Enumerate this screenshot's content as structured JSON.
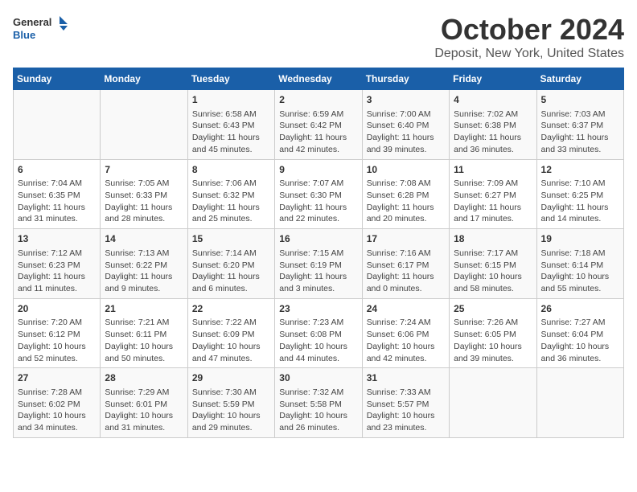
{
  "header": {
    "logo_line1": "General",
    "logo_line2": "Blue",
    "month_title": "October 2024",
    "location": "Deposit, New York, United States"
  },
  "weekdays": [
    "Sunday",
    "Monday",
    "Tuesday",
    "Wednesday",
    "Thursday",
    "Friday",
    "Saturday"
  ],
  "weeks": [
    [
      {
        "day": "",
        "info": ""
      },
      {
        "day": "",
        "info": ""
      },
      {
        "day": "1",
        "info": "Sunrise: 6:58 AM\nSunset: 6:43 PM\nDaylight: 11 hours and 45 minutes."
      },
      {
        "day": "2",
        "info": "Sunrise: 6:59 AM\nSunset: 6:42 PM\nDaylight: 11 hours and 42 minutes."
      },
      {
        "day": "3",
        "info": "Sunrise: 7:00 AM\nSunset: 6:40 PM\nDaylight: 11 hours and 39 minutes."
      },
      {
        "day": "4",
        "info": "Sunrise: 7:02 AM\nSunset: 6:38 PM\nDaylight: 11 hours and 36 minutes."
      },
      {
        "day": "5",
        "info": "Sunrise: 7:03 AM\nSunset: 6:37 PM\nDaylight: 11 hours and 33 minutes."
      }
    ],
    [
      {
        "day": "6",
        "info": "Sunrise: 7:04 AM\nSunset: 6:35 PM\nDaylight: 11 hours and 31 minutes."
      },
      {
        "day": "7",
        "info": "Sunrise: 7:05 AM\nSunset: 6:33 PM\nDaylight: 11 hours and 28 minutes."
      },
      {
        "day": "8",
        "info": "Sunrise: 7:06 AM\nSunset: 6:32 PM\nDaylight: 11 hours and 25 minutes."
      },
      {
        "day": "9",
        "info": "Sunrise: 7:07 AM\nSunset: 6:30 PM\nDaylight: 11 hours and 22 minutes."
      },
      {
        "day": "10",
        "info": "Sunrise: 7:08 AM\nSunset: 6:28 PM\nDaylight: 11 hours and 20 minutes."
      },
      {
        "day": "11",
        "info": "Sunrise: 7:09 AM\nSunset: 6:27 PM\nDaylight: 11 hours and 17 minutes."
      },
      {
        "day": "12",
        "info": "Sunrise: 7:10 AM\nSunset: 6:25 PM\nDaylight: 11 hours and 14 minutes."
      }
    ],
    [
      {
        "day": "13",
        "info": "Sunrise: 7:12 AM\nSunset: 6:23 PM\nDaylight: 11 hours and 11 minutes."
      },
      {
        "day": "14",
        "info": "Sunrise: 7:13 AM\nSunset: 6:22 PM\nDaylight: 11 hours and 9 minutes."
      },
      {
        "day": "15",
        "info": "Sunrise: 7:14 AM\nSunset: 6:20 PM\nDaylight: 11 hours and 6 minutes."
      },
      {
        "day": "16",
        "info": "Sunrise: 7:15 AM\nSunset: 6:19 PM\nDaylight: 11 hours and 3 minutes."
      },
      {
        "day": "17",
        "info": "Sunrise: 7:16 AM\nSunset: 6:17 PM\nDaylight: 11 hours and 0 minutes."
      },
      {
        "day": "18",
        "info": "Sunrise: 7:17 AM\nSunset: 6:15 PM\nDaylight: 10 hours and 58 minutes."
      },
      {
        "day": "19",
        "info": "Sunrise: 7:18 AM\nSunset: 6:14 PM\nDaylight: 10 hours and 55 minutes."
      }
    ],
    [
      {
        "day": "20",
        "info": "Sunrise: 7:20 AM\nSunset: 6:12 PM\nDaylight: 10 hours and 52 minutes."
      },
      {
        "day": "21",
        "info": "Sunrise: 7:21 AM\nSunset: 6:11 PM\nDaylight: 10 hours and 50 minutes."
      },
      {
        "day": "22",
        "info": "Sunrise: 7:22 AM\nSunset: 6:09 PM\nDaylight: 10 hours and 47 minutes."
      },
      {
        "day": "23",
        "info": "Sunrise: 7:23 AM\nSunset: 6:08 PM\nDaylight: 10 hours and 44 minutes."
      },
      {
        "day": "24",
        "info": "Sunrise: 7:24 AM\nSunset: 6:06 PM\nDaylight: 10 hours and 42 minutes."
      },
      {
        "day": "25",
        "info": "Sunrise: 7:26 AM\nSunset: 6:05 PM\nDaylight: 10 hours and 39 minutes."
      },
      {
        "day": "26",
        "info": "Sunrise: 7:27 AM\nSunset: 6:04 PM\nDaylight: 10 hours and 36 minutes."
      }
    ],
    [
      {
        "day": "27",
        "info": "Sunrise: 7:28 AM\nSunset: 6:02 PM\nDaylight: 10 hours and 34 minutes."
      },
      {
        "day": "28",
        "info": "Sunrise: 7:29 AM\nSunset: 6:01 PM\nDaylight: 10 hours and 31 minutes."
      },
      {
        "day": "29",
        "info": "Sunrise: 7:30 AM\nSunset: 5:59 PM\nDaylight: 10 hours and 29 minutes."
      },
      {
        "day": "30",
        "info": "Sunrise: 7:32 AM\nSunset: 5:58 PM\nDaylight: 10 hours and 26 minutes."
      },
      {
        "day": "31",
        "info": "Sunrise: 7:33 AM\nSunset: 5:57 PM\nDaylight: 10 hours and 23 minutes."
      },
      {
        "day": "",
        "info": ""
      },
      {
        "day": "",
        "info": ""
      }
    ]
  ]
}
